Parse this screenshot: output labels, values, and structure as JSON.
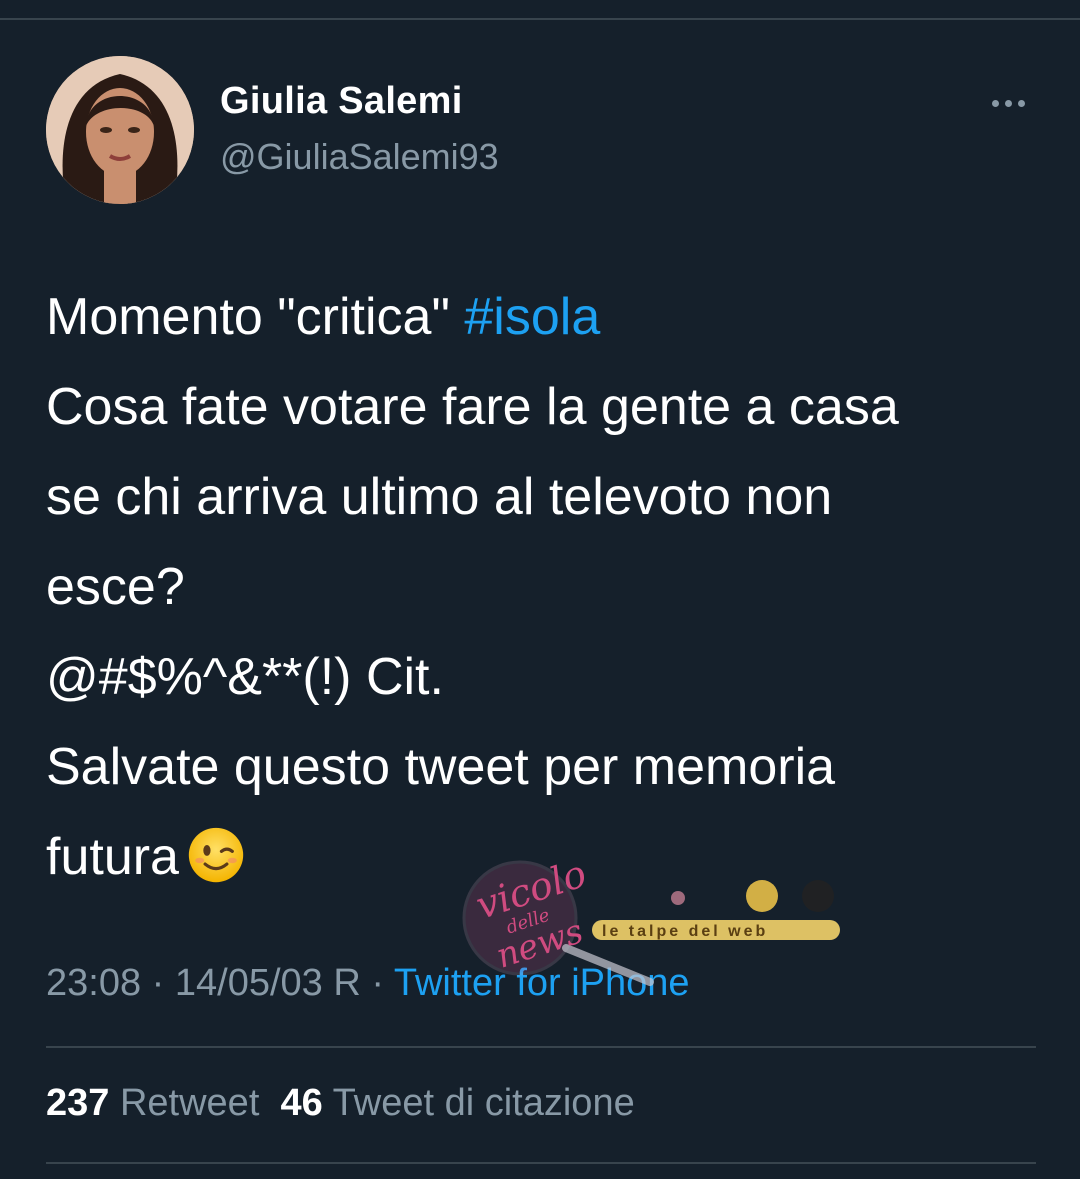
{
  "tweet": {
    "display_name": "Giulia Salemi",
    "handle": "@GiuliaSalemi93",
    "more_icon": "more-horizontal-icon",
    "lines": [
      {
        "text": "Momento \"critica\" ",
        "hashtag": "#isola"
      },
      {
        "text": "Cosa fate votare fare la gente a casa"
      },
      {
        "text": "se chi arriva ultimo al televoto non"
      },
      {
        "text": "esce?"
      },
      {
        "text": "@#$%^&**(!) Cit."
      },
      {
        "text": "Salvate questo tweet per memoria"
      },
      {
        "text": "futura",
        "emoji": "winking-face-emoji"
      }
    ],
    "timestamp": "23:08 · 14/05/03 R · ",
    "source": "Twitter for iPhone",
    "retweet_count": "237",
    "retweet_label": "Retweet",
    "quote_count": "46",
    "quote_label": "Tweet di citazione"
  },
  "watermark": {
    "script_top": "vicolo",
    "script_mid": "delle",
    "script_bottom": "news",
    "badge": "le talpe del web"
  },
  "colors": {
    "background": "#15202b",
    "divider": "#38444d",
    "secondary_text": "#8899a6",
    "accent": "#1da1f2"
  }
}
